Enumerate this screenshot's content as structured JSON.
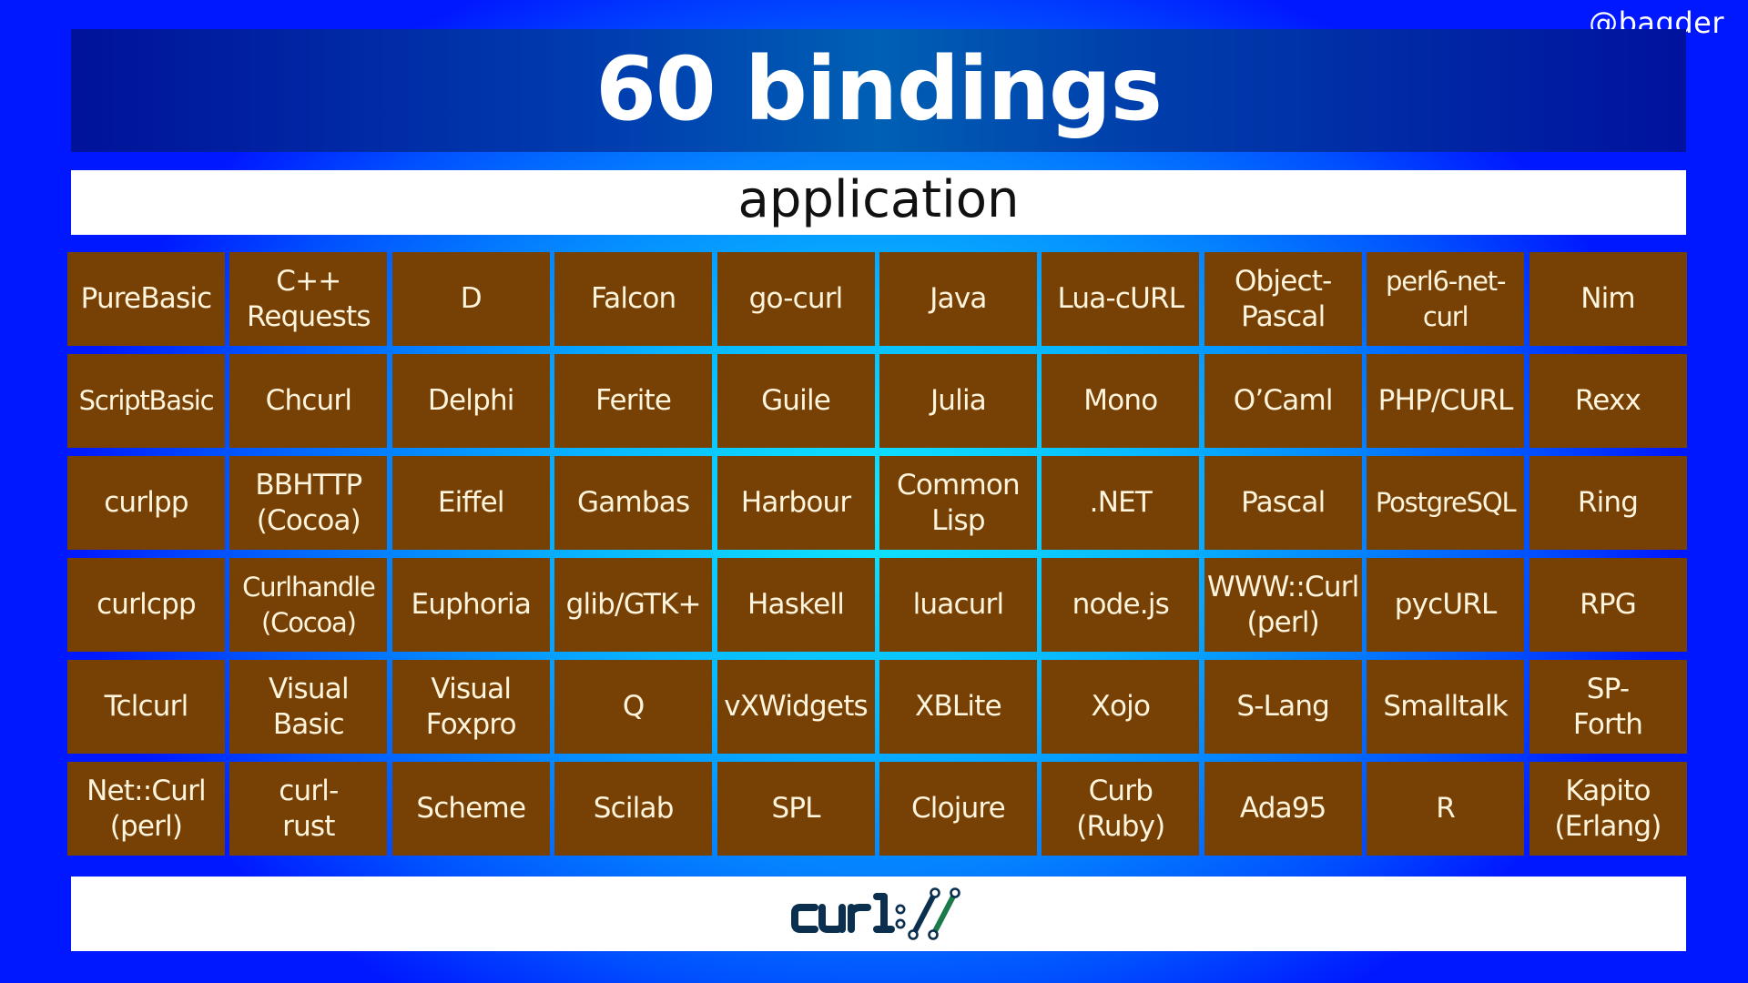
{
  "handle": "@bagder",
  "title": "60 bindings",
  "layer_label": "application",
  "colors": {
    "cell_bg": "#774105",
    "cell_text": "#fff4dc",
    "banner_bg": "#0040b0",
    "background_edge": "#0018ff",
    "background_center": "#10e8ff",
    "logo_navy": "#0b2f4e",
    "logo_green": "#1a7a4a"
  },
  "logo": {
    "icon": "curl-logo",
    "text": "curl://"
  },
  "bindings": [
    [
      "PureBasic",
      "C++\nRequests",
      "D",
      "Falcon",
      "go-curl",
      "Java",
      "Lua-cURL",
      "Object-\nPascal",
      "perl6-net-\ncurl",
      "Nim"
    ],
    [
      "ScriptBasic",
      "Chcurl",
      "Delphi",
      "Ferite",
      "Guile",
      "Julia",
      "Mono",
      "O’Caml",
      "PHP/CURL",
      "Rexx"
    ],
    [
      "curlpp",
      "BBHTTP\n(Cocoa)",
      "Eiffel",
      "Gambas",
      "Harbour",
      "Common\nLisp",
      ".NET",
      "Pascal",
      "PostgreSQL",
      "Ring"
    ],
    [
      "curlcpp",
      "Curlhandle\n(Cocoa)",
      "Euphoria",
      "glib/GTK+",
      "Haskell",
      "luacurl",
      "node.js",
      "WWW::Curl\n(perl)",
      "pycURL",
      "RPG"
    ],
    [
      "Tclcurl",
      "Visual\nBasic",
      "Visual\nFoxpro",
      "Q",
      "vXWidgets",
      "XBLite",
      "Xojo",
      "S-Lang",
      "Smalltalk",
      "SP-\nForth"
    ],
    [
      "Net::Curl\n(perl)",
      "curl-\nrust",
      "Scheme",
      "Scilab",
      "SPL",
      "Clojure",
      "Curb\n(Ruby)",
      "Ada95",
      "R",
      "Kapito\n(Erlang)"
    ]
  ]
}
